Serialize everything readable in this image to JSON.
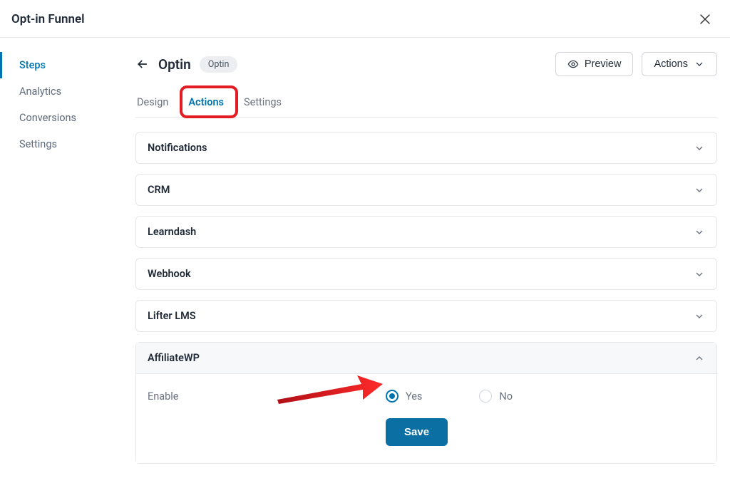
{
  "header": {
    "title": "Opt-in Funnel"
  },
  "sidebar": {
    "items": [
      "Steps",
      "Analytics",
      "Conversions",
      "Settings"
    ],
    "active_index": 0
  },
  "page": {
    "title": "Optin",
    "type_badge": "Optin",
    "preview_label": "Preview",
    "actions_label": "Actions"
  },
  "tabs": {
    "items": [
      "Design",
      "Actions",
      "Settings"
    ],
    "active_index": 1
  },
  "accordions": [
    {
      "title": "Notifications",
      "expanded": false
    },
    {
      "title": "CRM",
      "expanded": false
    },
    {
      "title": "Learndash",
      "expanded": false
    },
    {
      "title": "Webhook",
      "expanded": false
    },
    {
      "title": "Lifter LMS",
      "expanded": false
    },
    {
      "title": "AffiliateWP",
      "expanded": true
    }
  ],
  "affiliatewp": {
    "enable_label": "Enable",
    "option_yes": "Yes",
    "option_no": "No",
    "selected": "yes",
    "save_label": "Save"
  }
}
